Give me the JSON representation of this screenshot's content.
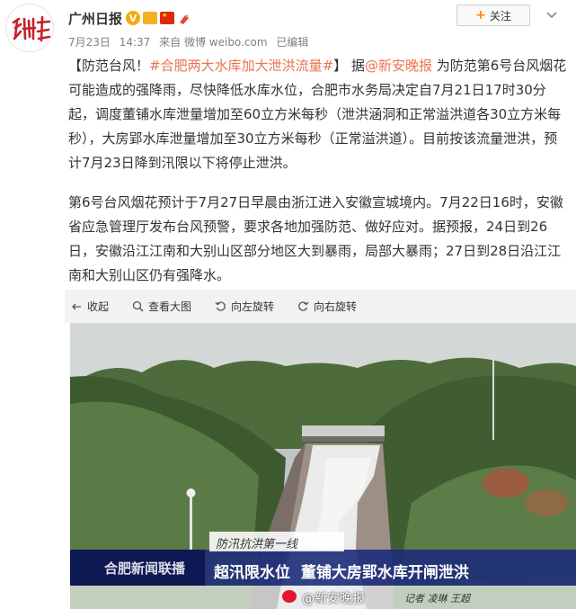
{
  "author": {
    "name": "广州日报",
    "verified_icon": "v-verified-icon"
  },
  "follow_button": {
    "label": "关注"
  },
  "meta": {
    "date": "7月23日",
    "time": "14:37",
    "source": "来自 微博 weibo.com",
    "edited": "已编辑"
  },
  "post": {
    "p1_a": "【防范台风！",
    "p1_hashtag": "#合肥两大水库加大泄洪流量#",
    "p1_b": "】 据",
    "p1_mention": "@新安晚报",
    "p1_c": " 为防范第6号台风烟花可能造成的强降雨，尽快降低水库水位，合肥市水务局决定自7月21日17时30分起，调度董铺水库泄量增加至60立方米每秒（泄洪涵洞和正常溢洪道各30立方米每秒），大房郢水库泄量增加至30立方米每秒（正常溢洪道）。目前按该流量泄洪，预计7月23日降到汛限以下将停止泄洪。",
    "p2": "第6号台风烟花预计于7月27日早晨由浙江进入安徽宣城境内。7月22日16时，安徽省应急管理厅发布台风预警，要求各地加强防范、做好应对。据预报，24日到26日，安徽沿江江南和大别山区部分地区大到暴雨，局部大暴雨；27日到28日沿江江南和大别山区仍有强降水。"
  },
  "toolbar": {
    "collapse": "收起",
    "view_large": "查看大图",
    "rotate_left": "向左旋转",
    "rotate_right": "向右旋转"
  },
  "image_overlay": {
    "logo": "合肥新闻联播",
    "caption_top": "防汛抗洪第一线",
    "headline": "超汛限水位  董铺大房郢水库开闸泄洪",
    "reporter": "记者 凌琳 王超",
    "watermark": "@新安晚报"
  },
  "colors": {
    "link": "#eb7350",
    "accent": "#ff8200",
    "meta": "#808080"
  }
}
